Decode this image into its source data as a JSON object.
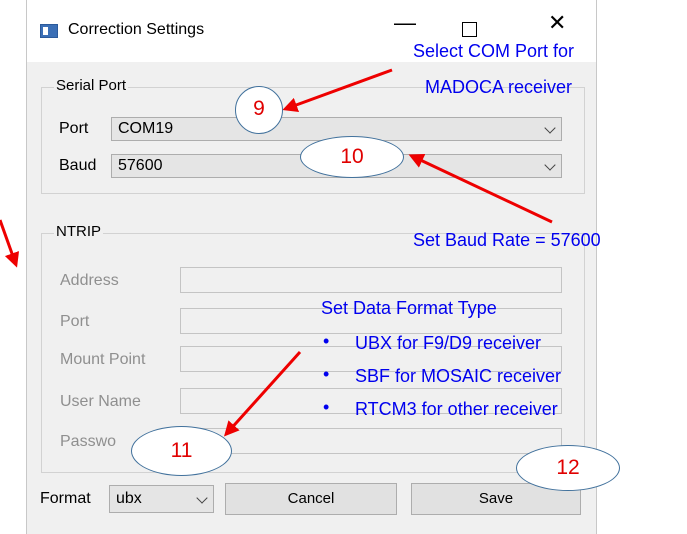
{
  "window": {
    "title": "Correction Settings",
    "controls": {
      "minimize": "—",
      "close": "✕"
    }
  },
  "serial": {
    "group_label": "Serial Port",
    "port_label": "Port",
    "port_value": "COM19",
    "baud_label": "Baud",
    "baud_value": "57600"
  },
  "ntrip": {
    "group_label": "NTRIP",
    "fields": [
      "Address",
      "Port",
      "Mount Point",
      "User Name",
      "Passwo"
    ]
  },
  "footer": {
    "format_label": "Format",
    "format_value": "ubx",
    "cancel": "Cancel",
    "save": "Save"
  },
  "annotations": {
    "com_port_line1": "Select COM Port for",
    "com_port_line2": "MADOCA receiver",
    "baud_note": "Set Baud Rate = 57600",
    "format_title": "Set Data Format Type",
    "bullet_symbol": "•",
    "bullets": [
      "UBX for F9/D9 receiver",
      "SBF for MOSAIC receiver",
      "RTCM3 for other receiver"
    ],
    "steps": [
      "9",
      "10",
      "11",
      "12"
    ]
  },
  "colors": {
    "annotation_text": "#0000ee",
    "arrow": "#ee0000",
    "step_number": "#e00000",
    "oval_border": "#41719c"
  }
}
